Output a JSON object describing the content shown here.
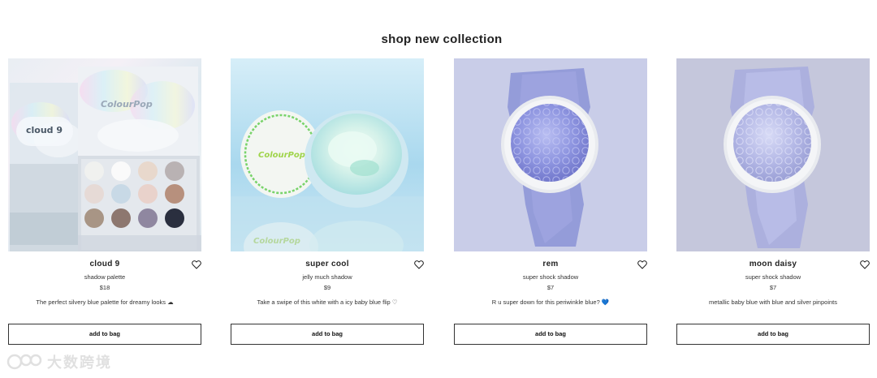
{
  "heading": "shop new collection",
  "products": [
    {
      "name": "cloud 9",
      "subtitle": "shadow palette",
      "price": "$18",
      "description": "The perfect silvery blue palette for dreamy looks ☁",
      "button": "add to bag",
      "wishlist_icon": "heart-outline-icon"
    },
    {
      "name": "super cool",
      "subtitle": "jelly much shadow",
      "price": "$9",
      "description": "Take a swipe of this white with a icy baby blue flip ♡",
      "button": "add to bag",
      "wishlist_icon": "heart-outline-icon"
    },
    {
      "name": "rem",
      "subtitle": "super shock shadow",
      "price": "$7",
      "description": "R u super down for this periwinkle blue? 💙",
      "button": "add to bag",
      "wishlist_icon": "heart-outline-icon"
    },
    {
      "name": "moon daisy",
      "subtitle": "super shock shadow",
      "price": "$7",
      "description": "metallic baby blue with blue and silver pinpoints",
      "button": "add to bag",
      "wishlist_icon": "heart-outline-icon"
    }
  ],
  "watermark": {
    "text": "大数跨境"
  },
  "colors": {
    "text": "#222222",
    "button_border": "#333333",
    "card2_bg": "#bfe3f2",
    "card3_bg": "#c9cde8",
    "card4_bg": "#c5c7dc"
  }
}
